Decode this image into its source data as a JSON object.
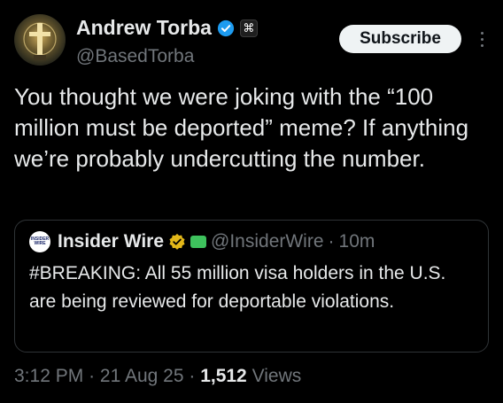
{
  "author": {
    "display_name": "Andrew Torba",
    "handle": "@BasedTorba",
    "affiliate_badge_glyph": "⌘"
  },
  "subscribe_label": "Subscribe",
  "tweet_text": "You thought we were joking with the “100 million must be deported” meme? If anything we’re probably undercutting the number.",
  "quote": {
    "logo_text_line1": "INSIDER",
    "logo_text_line2": "WIRE",
    "display_name": "Insider Wire",
    "handle": "@InsiderWire",
    "separator": "·",
    "time": "10m",
    "text": "#BREAKING: All 55 million visa holders in the U.S. are being reviewed for deportable violations."
  },
  "meta": {
    "time": "3:12 PM",
    "separator": "·",
    "date": "21 Aug 25",
    "views_count": "1,512",
    "views_label": "Views"
  },
  "colors": {
    "background": "#000000",
    "text": "#e7e9ea",
    "secondary": "#71767b",
    "verified_blue": "#1d9bf0",
    "verified_gold": "#e2b719",
    "border": "#2f3336"
  }
}
